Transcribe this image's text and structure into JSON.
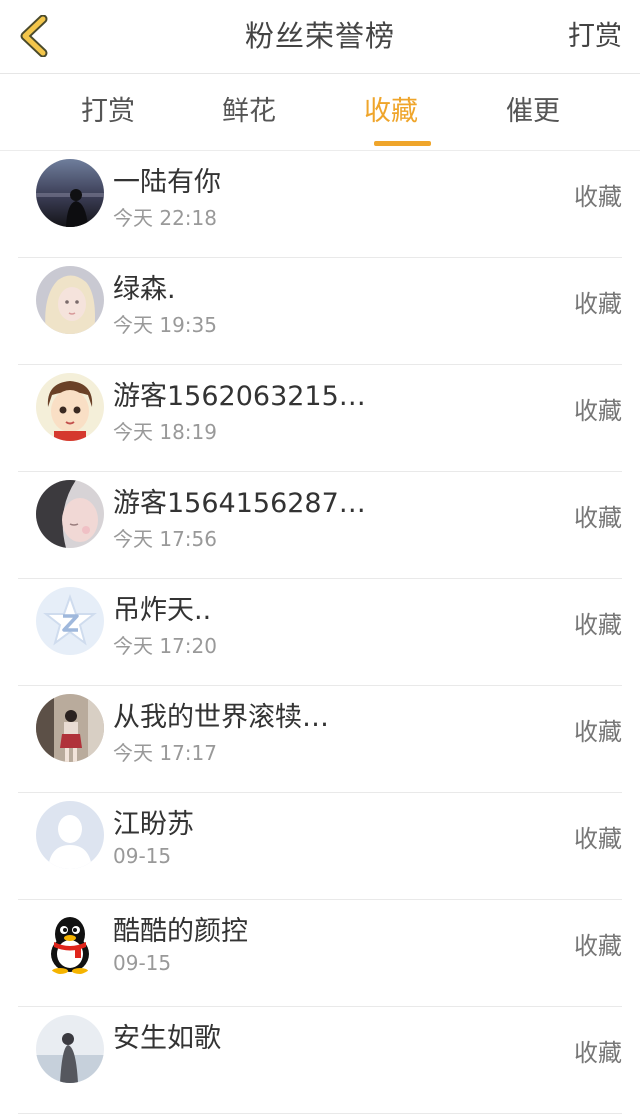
{
  "header": {
    "title": "粉丝荣誉榜",
    "action": "打赏"
  },
  "tabs": [
    {
      "label": "打赏",
      "active": false
    },
    {
      "label": "鲜花",
      "active": false
    },
    {
      "label": "收藏",
      "active": true
    },
    {
      "label": "催更",
      "active": false
    }
  ],
  "list": [
    {
      "name": "一陆有你",
      "time": "今天 22:18",
      "action": "收藏",
      "avatar": "photo-dusk-avatar"
    },
    {
      "name": "绿森.",
      "time": "今天 19:35",
      "action": "收藏",
      "avatar": "photo-blonde-avatar"
    },
    {
      "name": "游客1562063215…",
      "time": "今天 18:19",
      "action": "收藏",
      "avatar": "cartoon-boy-avatar"
    },
    {
      "name": "游客1564156287…",
      "time": "今天 17:56",
      "action": "收藏",
      "avatar": "photo-girl-avatar"
    },
    {
      "name": "吊炸天..",
      "time": "今天 17:20",
      "action": "收藏",
      "avatar": "star-z-avatar"
    },
    {
      "name": "从我的世界滚犊…",
      "time": "今天 17:17",
      "action": "收藏",
      "avatar": "photo-street-avatar"
    },
    {
      "name": "江盼苏",
      "time": "09-15",
      "action": "收藏",
      "avatar": "default-person-avatar"
    },
    {
      "name": "酷酷的颜控",
      "time": "09-15",
      "action": "收藏",
      "avatar": "penguin-avatar"
    },
    {
      "name": "安生如歌",
      "time": "",
      "action": "收藏",
      "avatar": "photo-winter-avatar"
    }
  ],
  "colors": {
    "accent": "#efa52b",
    "divider": "#e9e9e9"
  }
}
